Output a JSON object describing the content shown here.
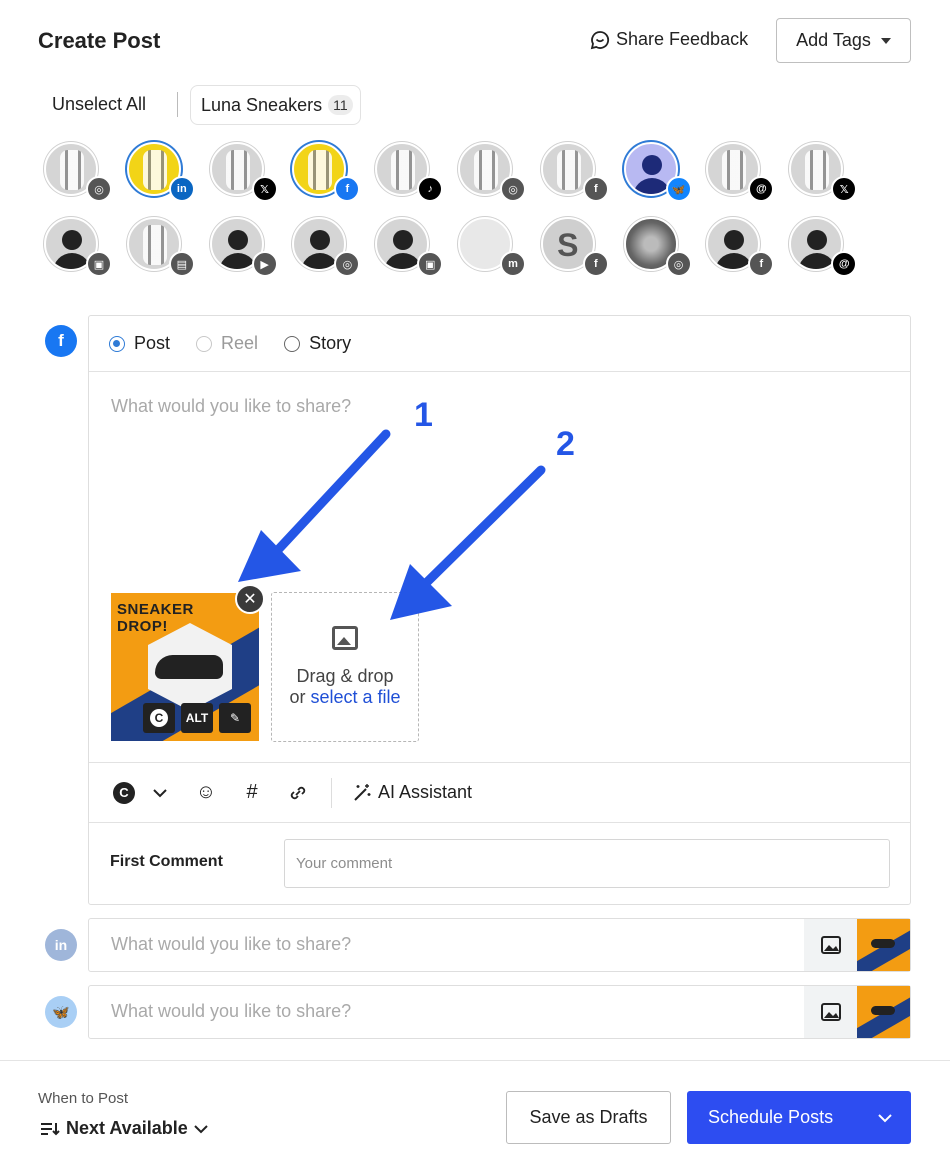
{
  "header": {
    "title": "Create Post",
    "share_feedback": "Share Feedback",
    "add_tags": "Add Tags"
  },
  "accounts": {
    "unselect_all": "Unselect All",
    "group_name": "Luna Sneakers",
    "group_count": "11",
    "avatars_row1": [
      {
        "badge": "instagram-icon",
        "color": "#555",
        "selected": false
      },
      {
        "badge": "linkedin-icon",
        "color": "#0a66c2",
        "selected": true
      },
      {
        "badge": "x-icon",
        "color": "#000",
        "selected": false
      },
      {
        "badge": "facebook-icon",
        "color": "#1877f2",
        "selected": true
      },
      {
        "badge": "tiktok-icon",
        "color": "#000",
        "selected": false
      },
      {
        "badge": "instagram-icon",
        "color": "#555",
        "selected": false
      },
      {
        "badge": "facebook-icon",
        "color": "#555",
        "selected": false
      },
      {
        "badge": "bluesky-icon",
        "color": "#1185fe",
        "selected": true
      },
      {
        "badge": "threads-icon",
        "color": "#000",
        "selected": false
      },
      {
        "badge": "x-icon",
        "color": "#000",
        "selected": false
      }
    ],
    "avatars_row2": [
      {
        "badge": "gmb-icon",
        "color": "#555",
        "letter": ""
      },
      {
        "badge": "profile-card-icon",
        "color": "#555",
        "letter": ""
      },
      {
        "badge": "youtube-icon",
        "color": "#555",
        "letter": ""
      },
      {
        "badge": "instagram-icon",
        "color": "#555",
        "letter": ""
      },
      {
        "badge": "gmb-icon",
        "color": "#555",
        "letter": ""
      },
      {
        "badge": "mastodon-icon",
        "color": "#555",
        "letter": ""
      },
      {
        "badge": "facebook-icon",
        "color": "#555",
        "letter": "S"
      },
      {
        "badge": "instagram-icon",
        "color": "#555",
        "letter": ""
      },
      {
        "badge": "facebook-icon",
        "color": "#555",
        "letter": ""
      },
      {
        "badge": "threads-icon",
        "color": "#000",
        "letter": ""
      }
    ]
  },
  "composer": {
    "post_types": [
      {
        "label": "Post",
        "state": "selected"
      },
      {
        "label": "Reel",
        "state": "disabled"
      },
      {
        "label": "Story",
        "state": "unselected"
      }
    ],
    "placeholder": "What would you like to share?",
    "thumbnail": {
      "headline": "SNEAKER DROP!",
      "alt_label": "ALT",
      "c_label": "C"
    },
    "dropzone": {
      "line1": "Drag & drop",
      "line2_prefix": "or",
      "link": "select a file"
    },
    "toolbar": {
      "ai_assistant": "AI Assistant"
    },
    "first_comment": {
      "label": "First Comment",
      "placeholder": "Your comment"
    }
  },
  "other_networks": [
    {
      "network": "linkedin-icon",
      "placeholder": "What would you like to share?"
    },
    {
      "network": "bluesky-icon",
      "placeholder": "What would you like to share?"
    }
  ],
  "annotations": {
    "arrow1": "1",
    "arrow2": "2"
  },
  "footer": {
    "when_to_post": "When to Post",
    "next_available": "Next Available",
    "save_drafts": "Save as Drafts",
    "schedule": "Schedule Posts"
  },
  "colors": {
    "accent": "#2d4df1",
    "facebook": "#1877f2",
    "arrow": "#2456e6"
  }
}
